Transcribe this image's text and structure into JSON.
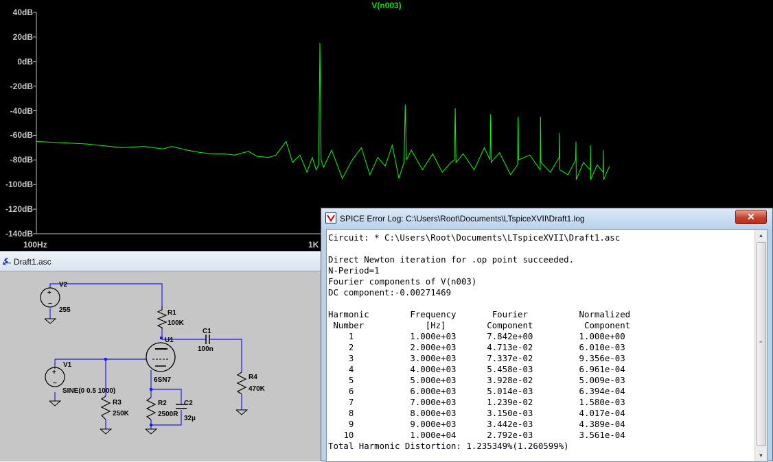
{
  "plot": {
    "trace_name": "V(n003)",
    "y_ticks": [
      "40dB",
      "20dB",
      "0dB",
      "-20dB",
      "-40dB",
      "-60dB",
      "-80dB",
      "-100dB",
      "-120dB",
      "-140dB"
    ],
    "x_ticks": [
      "100Hz",
      "1K"
    ],
    "trace_color": "#00ff00",
    "background": "#000000"
  },
  "chart_data": {
    "type": "line",
    "title": "V(n003)",
    "xlabel": "",
    "ylabel": "",
    "x_scale": "log",
    "x_unit": "Hz",
    "ylim": [
      -140,
      40
    ],
    "grid": false,
    "series": [
      {
        "name": "V(n003)",
        "x": [
          100,
          150,
          200,
          240,
          280,
          300,
          340,
          380,
          420,
          460,
          500,
          560,
          600,
          660,
          700,
          760,
          800,
          850,
          900,
          940,
          970,
          990,
          1000,
          1010,
          1030,
          1100,
          1200,
          1300,
          1400,
          1500,
          1600,
          1700,
          1800,
          1900,
          1980,
          2000,
          2020,
          2100,
          2300,
          2500,
          2700,
          2900,
          2980,
          3000,
          3020,
          3200,
          3500,
          3800,
          3980,
          4000,
          4020,
          4300,
          4700,
          4980,
          5000,
          5020,
          5500,
          5980,
          6000,
          6020,
          6500,
          6980,
          7000,
          7020,
          7500,
          7980,
          8000,
          8020,
          8500,
          8980,
          9000,
          9020,
          9500,
          9980,
          10000,
          10020,
          10500
        ],
        "values": [
          -65,
          -67,
          -70,
          -69,
          -71,
          -69,
          -72,
          -74,
          -75,
          -75,
          -76,
          -73,
          -77,
          -78,
          -76,
          -65,
          -82,
          -76,
          -90,
          -78,
          -88,
          -84,
          15,
          -80,
          -86,
          -72,
          -95,
          -80,
          -70,
          -92,
          -78,
          -85,
          -68,
          -95,
          -82,
          -35,
          -80,
          -72,
          -88,
          -75,
          -90,
          -82,
          -80,
          -38,
          -82,
          -75,
          -88,
          -70,
          -80,
          -43,
          -82,
          -74,
          -92,
          -84,
          -45,
          -80,
          -76,
          -88,
          -45,
          -82,
          -90,
          -78,
          -58,
          -88,
          -92,
          -80,
          -65,
          -96,
          -82,
          -88,
          -68,
          -96,
          -84,
          -90,
          -72,
          -96,
          -85
        ]
      }
    ]
  },
  "schematic": {
    "tab_title": "Draft1.asc",
    "labels": {
      "v2": "V2",
      "v2_value": "255",
      "r1": "R1",
      "r1_value": "100K",
      "u1": "U1",
      "tube_model": "6SN7",
      "c1": "C1",
      "c1_value": "100n",
      "r4": "R4",
      "r4_value": "470K",
      "v1": "V1",
      "v1_value": "SINE(0 0.5 1000)",
      "r3": "R3",
      "r3_value": "250K",
      "r2": "R2",
      "r2_value": "2500R",
      "c2": "C2",
      "c2_value": "32µ"
    }
  },
  "log": {
    "window_title": "SPICE Error Log: C:\\Users\\Root\\Documents\\LTspiceXVII\\Draft1.log",
    "close_label": "✕",
    "lines": [
      "Circuit: * C:\\Users\\Root\\Documents\\LTspiceXVII\\Draft1.asc",
      "",
      "Direct Newton iteration for .op point succeeded.",
      "N-Period=1",
      "Fourier components of V(n003)",
      "DC component:-0.00271469",
      "",
      "Harmonic        Frequency       Fourier          Normalized",
      " Number            [Hz]        Component          Component",
      "    1           1.000e+03      7.842e+00         1.000e+00",
      "    2           2.000e+03      4.713e-02         6.010e-03",
      "    3           3.000e+03      7.337e-02         9.356e-03",
      "    4           4.000e+03      5.458e-03         6.961e-04",
      "    5           5.000e+03      3.928e-02         5.009e-03",
      "    6           6.000e+03      5.014e-03         6.394e-04",
      "    7           7.000e+03      1.239e-02         1.580e-03",
      "    8           8.000e+03      3.150e-03         4.017e-04",
      "    9           9.000e+03      3.442e-03         4.389e-04",
      "   10           1.000e+04      2.792e-03         3.561e-04",
      "Total Harmonic Distortion: 1.235349%(1.260599%)"
    ]
  }
}
